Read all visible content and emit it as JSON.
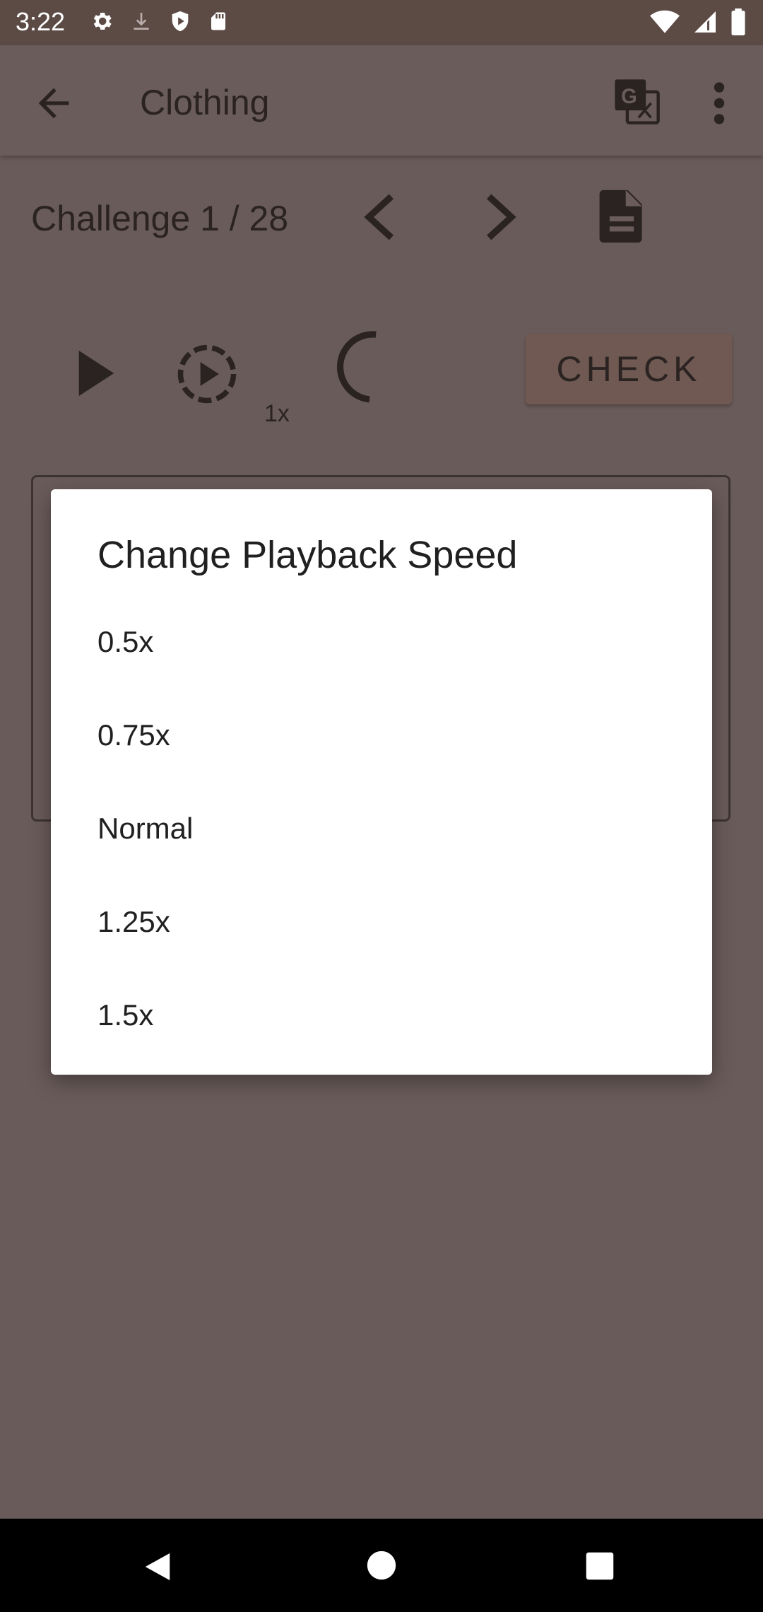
{
  "status_bar": {
    "time": "3:22"
  },
  "app_bar": {
    "title": "Clothing"
  },
  "challenge": {
    "label": "Challenge 1 / 28"
  },
  "player": {
    "speed_label": "1x",
    "check_label": "CHECK"
  },
  "dialog": {
    "title": "Change Playback Speed",
    "options": [
      "0.5x",
      "0.75x",
      "Normal",
      "1.25x",
      "1.5x"
    ]
  },
  "colors": {
    "scrim": "#695b59",
    "status_bar": "#5c4a45",
    "dialog_bg": "#ffffff",
    "nav_bar": "#000000"
  }
}
